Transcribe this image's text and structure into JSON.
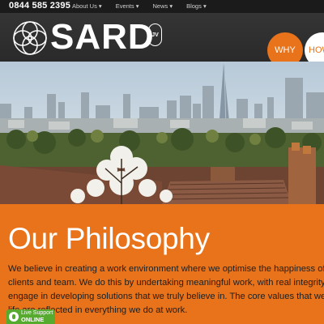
{
  "topbar": {
    "phone": "0844 585 2395",
    "nav": [
      {
        "label": "About Us ▾"
      },
      {
        "label": "Events ▾"
      },
      {
        "label": "News ▾"
      },
      {
        "label": "Blogs ▾"
      }
    ]
  },
  "header": {
    "logo_text": "SARD",
    "logo_badge": "JV",
    "circle_buttons": {
      "why": "WHY",
      "how": "HOW"
    }
  },
  "hero": {
    "image": "london-skyline-photo"
  },
  "main": {
    "heading": "Our Philosophy",
    "paragraph_lines": [
      "We believe in creating a work environment where we optimise the happiness of",
      "clients and team. We do this by undertaking meaningful work, with real integrity,",
      "engage in developing solutions that we truly believe in. The core values that we",
      "life are reflected in everything we do at work."
    ]
  },
  "live_support": {
    "line1": "Live Support",
    "line2": "ONLINE"
  },
  "colors": {
    "brand_orange": "#e8731a",
    "topbar": "#1b1b1b",
    "header": "#2f2f2f",
    "support_green": "#56ab2f"
  }
}
